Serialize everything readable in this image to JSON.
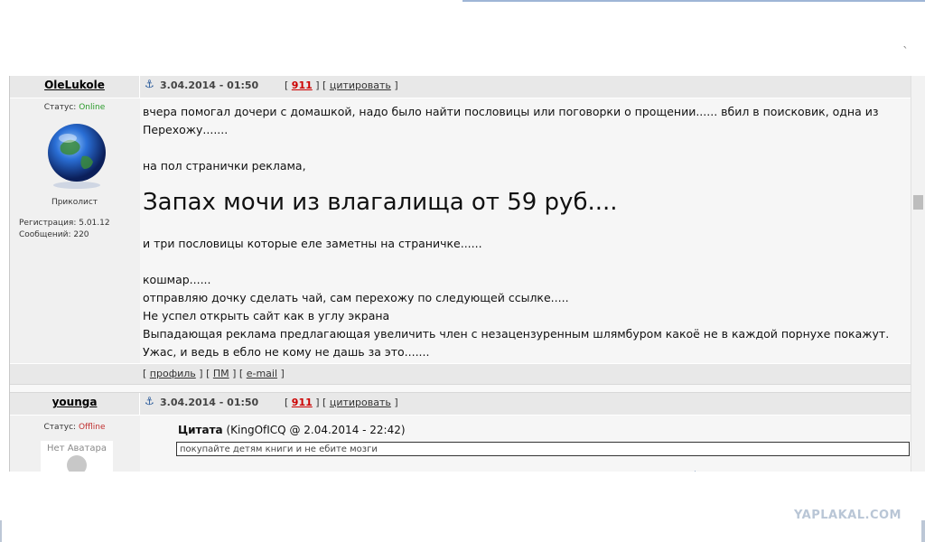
{
  "posts": [
    {
      "author": "OleLukole",
      "date": "3.04.2014 - 01:50",
      "post_number": "911",
      "quote_label": "цитировать",
      "status_label": "Статус:",
      "status_value": "Online",
      "rank": "Приколист",
      "registration": "Регистрация: 5.01.12",
      "messages": "Сообщений: 220",
      "body_lines": [
        "вчера помогал дочери с домашкой, надо было найти пословицы или поговорки о прощении...... вбил в поисковик, одна из",
        "Перехожу.......",
        "на пол странички реклама,",
        "и три пословицы которые еле заметны на страничке......",
        "кошмар......",
        "отправляю дочку сделать чай, сам перехожу по следующей ссылке.....",
        "Не успел открыть сайт как в углу экрана",
        "Выпадающая реклама предлагающая увеличить член с незацензуренным шлямбуром какоё не в каждой порнухе покажут.",
        "Ужас, и ведь в ебло не кому не дашь за это......."
      ],
      "big_line": "Запах мочи из влагалища от 59 руб....",
      "footer": {
        "profile": "профиль",
        "pm": "ПМ",
        "email": "e-mail"
      }
    },
    {
      "author": "younga",
      "date": "3.04.2014 - 01:50",
      "post_number": "911",
      "quote_label": "цитировать",
      "status_label": "Статус:",
      "status_value": "Offline",
      "no_avatar": "Нет Аватара",
      "quote_title": "Цитата",
      "quote_source": "(KingOfICQ @ 2.04.2014 - 22:42)",
      "quote_text": "покупайте детям книги и не ебите мозги"
    }
  ],
  "watermark": "YAPLAKAL.COM",
  "colors": {
    "online": "#2a9a2a",
    "offline": "#c03030",
    "post_number": "#c00000",
    "header_bg": "#e8e8e8"
  },
  "icons": {
    "anchor": "anchor-icon",
    "avatar": "globe-avatar"
  }
}
